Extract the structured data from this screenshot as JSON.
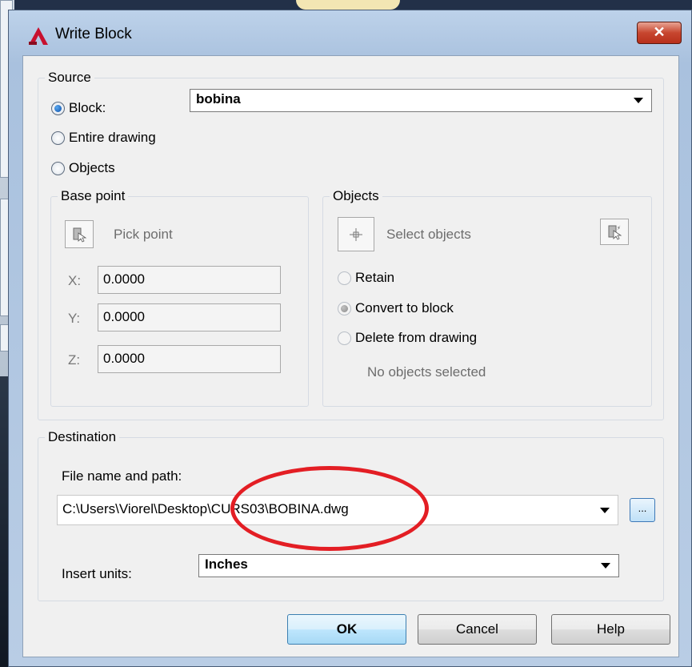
{
  "window": {
    "title": "Write Block",
    "close_label": "✕"
  },
  "source": {
    "label": "Source",
    "options": [
      "Block:",
      "Entire drawing",
      "Objects"
    ],
    "selected": "Block:",
    "block_name": "bobina"
  },
  "base_point": {
    "label": "Base point",
    "pick_label": "Pick point",
    "x_label": "X:",
    "x_value": "0.0000",
    "y_label": "Y:",
    "y_value": "0.0000",
    "z_label": "Z:",
    "z_value": "0.0000"
  },
  "objects": {
    "label": "Objects",
    "select_label": "Select objects",
    "options": [
      "Retain",
      "Convert to block",
      "Delete from drawing"
    ],
    "selected": "Convert to block",
    "status": "No objects selected"
  },
  "destination": {
    "label": "Destination",
    "file_label": "File name and path:",
    "file_value": "C:\\Users\\Viorel\\Desktop\\CURS03\\BOBINA.dwg",
    "browse_label": "...",
    "units_label": "Insert units:",
    "units_value": "Inches"
  },
  "buttons": {
    "ok": "OK",
    "cancel": "Cancel",
    "help": "Help"
  },
  "colors": {
    "annotation": "#e31e24",
    "accent": "#0c4ea8",
    "app_icon": "#c8102e"
  }
}
